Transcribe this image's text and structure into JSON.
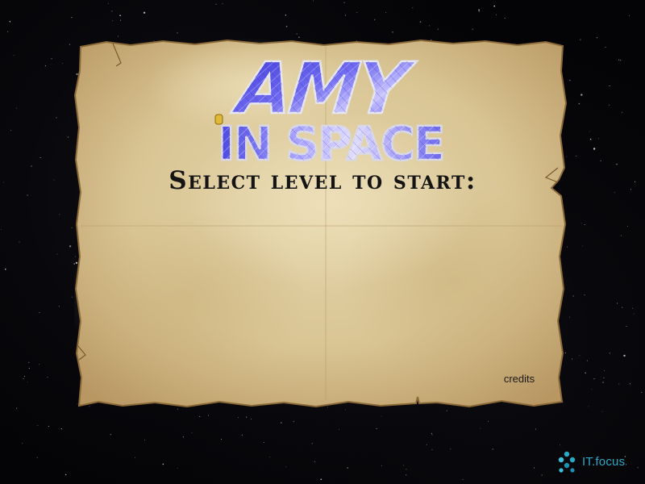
{
  "game": {
    "title_line1": "AMY",
    "title_line2": "IN SPACE",
    "prompt": "Select level to start:",
    "credits_label": "credits"
  },
  "brand": {
    "text": "IT.focus"
  },
  "colors": {
    "background": "#040406",
    "parchment": "#d9c79a",
    "parchment_edge": "#a8844d",
    "logo_fill": "#4a46e0",
    "logo_highlight": "#c9c4ff",
    "logo_outline": "#c8c8d8",
    "prompt_text": "#141414",
    "brand_teal": "#2aa8c8"
  },
  "icons": {
    "brand_logo": "itfocus-logo-icon"
  }
}
